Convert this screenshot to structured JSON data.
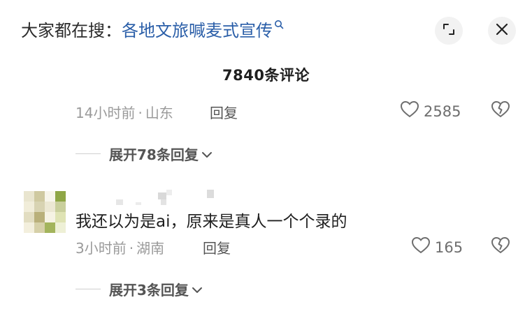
{
  "header": {
    "search_prefix": "大家都在搜：",
    "search_query": "各地文旅喊麦式宣传",
    "expand_icon": "expand-icon",
    "close_icon": "close-icon"
  },
  "comments_count_label": "7840条评论",
  "comments": [
    {
      "time": "14小时前",
      "separator": "·",
      "location": "山东",
      "reply_label": "回复",
      "likes": "2585",
      "expand_label": "展开78条回复"
    },
    {
      "username": "",
      "text": "我还以为是ai，原来是真人一个个录的",
      "time": "3小时前",
      "separator": "·",
      "location": "湖南",
      "reply_label": "回复",
      "likes": "165",
      "expand_label": "展开3条回复"
    }
  ],
  "colors": {
    "link": "#2a5ea8",
    "muted": "#9a9a9a",
    "icon_bg": "#f2f2f2"
  }
}
